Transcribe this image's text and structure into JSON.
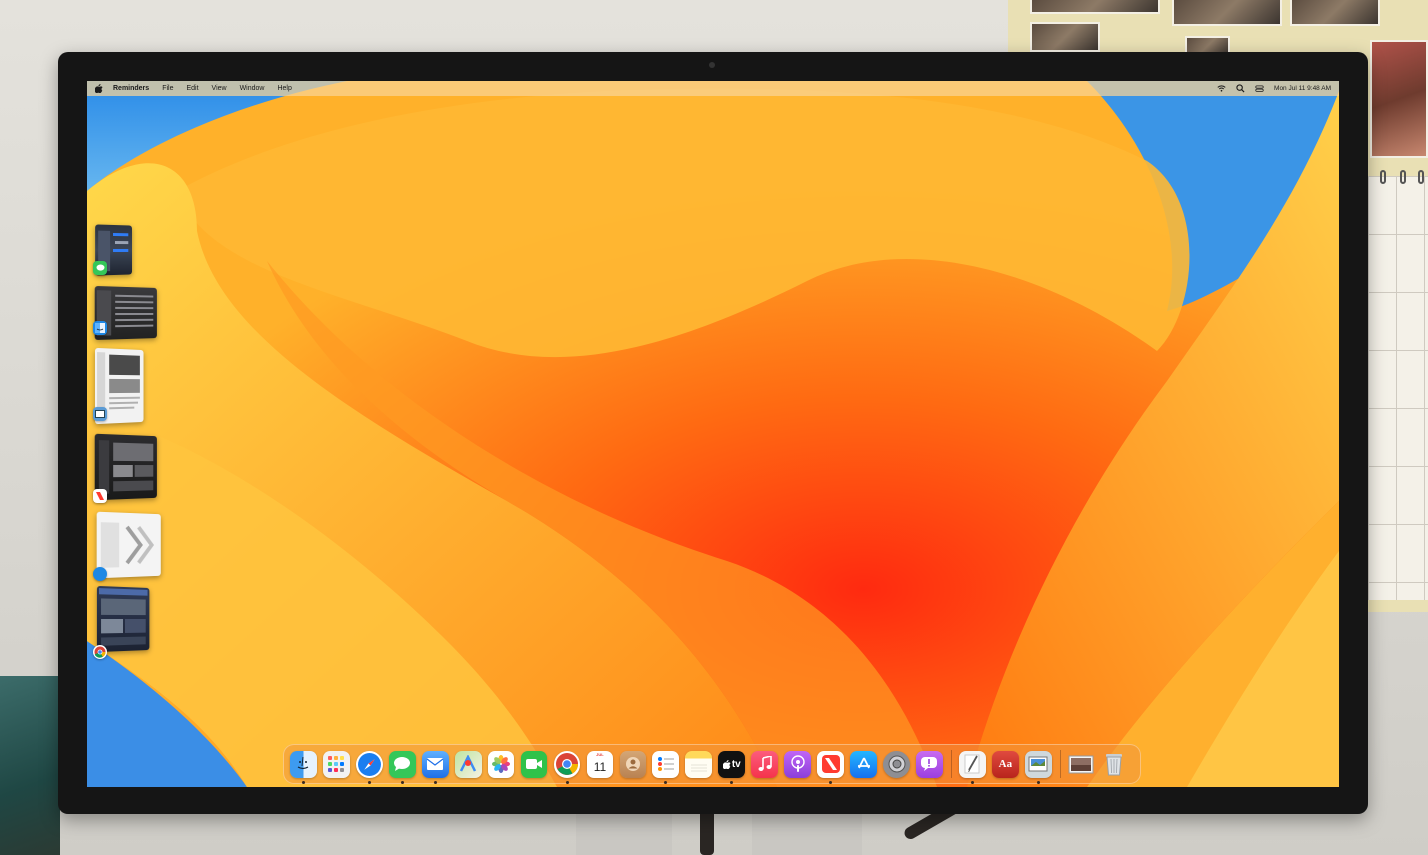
{
  "menubar": {
    "app_name": "Reminders",
    "menus": [
      "File",
      "Edit",
      "View",
      "Window",
      "Help"
    ],
    "clock": "Mon Jul 11  9:48 AM",
    "status_icons": [
      "wifi-icon",
      "search-icon",
      "control-center-icon"
    ]
  },
  "stage_manager": [
    {
      "app": "Messages",
      "badge_color": "#34c759",
      "icon": "messages-icon"
    },
    {
      "app": "Finder",
      "badge_color": "#1e88e5",
      "icon": "finder-icon"
    },
    {
      "app": "Preview",
      "badge_color": "#5b9bd5",
      "icon": "preview-icon"
    },
    {
      "app": "News",
      "badge_color": "#ff3b30",
      "icon": "news-icon"
    },
    {
      "app": "Safari",
      "badge_color": "#1e88e5",
      "icon": "safari-icon"
    },
    {
      "app": "Chrome",
      "badge_color": "#e8eaed",
      "icon": "chrome-icon"
    }
  ],
  "dock": {
    "apps": [
      {
        "name": "Finder",
        "icon": "finder-icon",
        "color": "#3d9bf0",
        "running": true
      },
      {
        "name": "Launchpad",
        "icon": "launchpad-icon",
        "color": "#f2f2f2",
        "running": false
      },
      {
        "name": "Safari",
        "icon": "safari-icon",
        "color": "#1a7ef0",
        "running": true
      },
      {
        "name": "Messages",
        "icon": "messages-icon",
        "color": "#34c759",
        "running": true
      },
      {
        "name": "Mail",
        "icon": "mail-icon",
        "color": "#2f86f6",
        "running": true
      },
      {
        "name": "Maps",
        "icon": "maps-icon",
        "color": "#9bd37a",
        "running": false
      },
      {
        "name": "Photos",
        "icon": "photos-icon",
        "color": "#ffffff",
        "running": false
      },
      {
        "name": "FaceTime",
        "icon": "facetime-icon",
        "color": "#2fc24a",
        "running": false
      },
      {
        "name": "Chrome",
        "icon": "chrome-icon",
        "color": "#ffffff",
        "running": true
      },
      {
        "name": "Calendar",
        "icon": "calendar-icon",
        "color": "#ffffff",
        "running": false,
        "month": "JUL",
        "day": "11"
      },
      {
        "name": "Contacts",
        "icon": "contacts-icon",
        "color": "#c99a6b",
        "running": false
      },
      {
        "name": "Reminders",
        "icon": "reminders-icon",
        "color": "#ffffff",
        "running": true
      },
      {
        "name": "Notes",
        "icon": "notes-icon",
        "color": "#ffd95a",
        "running": false
      },
      {
        "name": "TV",
        "icon": "tv-icon",
        "color": "#111111",
        "running": true,
        "label": "tv"
      },
      {
        "name": "Music",
        "icon": "music-icon",
        "color": "#fa3d5a",
        "running": false
      },
      {
        "name": "Podcasts",
        "icon": "podcasts-icon",
        "color": "#9b4be0",
        "running": false
      },
      {
        "name": "News",
        "icon": "news-icon",
        "color": "#ffffff",
        "running": true
      },
      {
        "name": "App Store",
        "icon": "app-store-icon",
        "color": "#1e90ff",
        "running": false
      },
      {
        "name": "System Settings",
        "icon": "settings-icon",
        "color": "#8e8e93",
        "running": false
      },
      {
        "name": "Feedback Assistant",
        "icon": "feedback-icon",
        "color": "#b14be8",
        "running": false
      }
    ],
    "secondary": [
      {
        "name": "TextEdit",
        "icon": "textedit-icon",
        "color": "#f5f5f5",
        "running": true
      },
      {
        "name": "Dictionary",
        "icon": "dictionary-icon",
        "color": "#d9342b",
        "running": false,
        "label": "Aa"
      },
      {
        "name": "Preview",
        "icon": "preview-icon",
        "color": "#cfd8dc",
        "running": true
      }
    ],
    "tail": [
      {
        "name": "Downloads Stack",
        "icon": "photo-stack-icon",
        "color": "#bcaaa4",
        "running": false
      },
      {
        "name": "Trash",
        "icon": "trash-icon",
        "color": "#d0d4d8",
        "running": false
      }
    ]
  }
}
